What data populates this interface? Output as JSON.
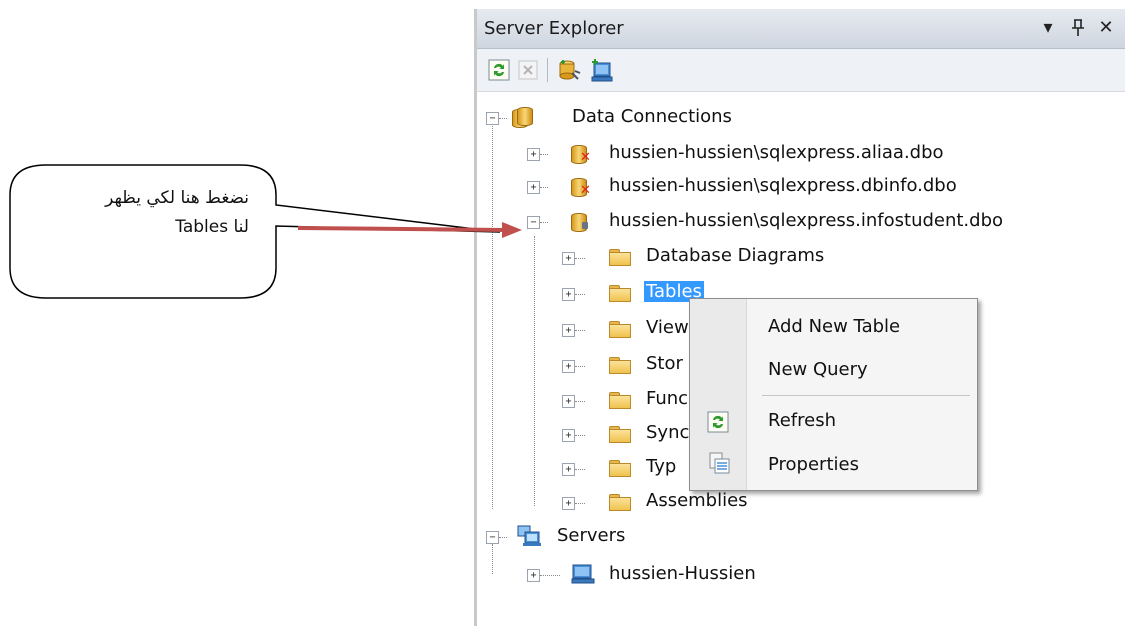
{
  "panel": {
    "title": "Server Explorer",
    "dropdown_glyph": "▾",
    "pin_glyph": "ꟸ",
    "close_glyph": "✕"
  },
  "toolbar": {
    "icons": [
      "refresh-icon",
      "stop-icon",
      "connect-to-database-icon",
      "connect-to-server-icon"
    ]
  },
  "tree": {
    "data_connections": "Data Connections",
    "connections": [
      "hussien-hussien\\sqlexpress.aliaa.dbo",
      "hussien-hussien\\sqlexpress.dbinfo.dbo",
      "hussien-hussien\\sqlexpress.infostudent.dbo"
    ],
    "folders": [
      "Database Diagrams",
      "Tables",
      "Views",
      "Stored Procedures",
      "Functions",
      "Synonyms",
      "Types",
      "Assemblies"
    ],
    "folders_visible": [
      "Database Diagrams",
      "Tables",
      "View",
      "Stor",
      "Func",
      "Sync",
      "Typ",
      "Assemblies"
    ],
    "servers": "Servers",
    "server_node": "hussien-Hussien"
  },
  "context_menu": {
    "items": [
      "Add New Table",
      "New Query",
      "Refresh",
      "Properties"
    ]
  },
  "callout": {
    "line1": "نضغط هنا لكي يظهر",
    "line2": "لنا Tables"
  },
  "colors": {
    "selection": "#3399ff",
    "arrow": "#c0504d",
    "folder": "#f0c24e"
  }
}
